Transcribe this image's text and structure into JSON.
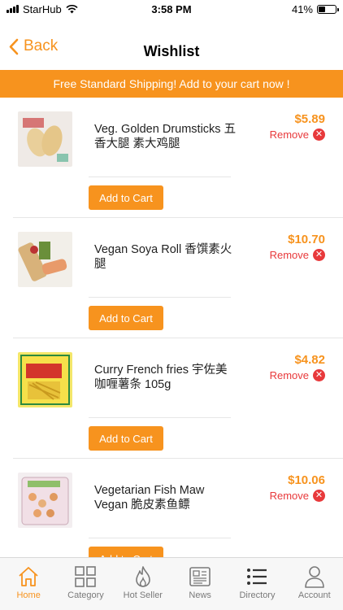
{
  "status_bar": {
    "carrier": "StarHub",
    "time": "3:58 PM",
    "battery_text": "41%",
    "battery_level": 0.41
  },
  "nav": {
    "back_label": "Back",
    "title": "Wishlist"
  },
  "banner": {
    "text": "Free Standard Shipping! Add to your cart now !"
  },
  "items": [
    {
      "name": "Veg. Golden Drumsticks 五香大腿 素大鸡腿",
      "price": "$5.89",
      "remove_label": "Remove",
      "cta": "Add to Cart"
    },
    {
      "name": "Vegan Soya Roll 香馔素火腿",
      "price": "$10.70",
      "remove_label": "Remove",
      "cta": "Add to Cart"
    },
    {
      "name": "Curry French fries 宇佐美咖喱薯条 105g",
      "price": "$4.82",
      "remove_label": "Remove",
      "cta": "Add to Cart"
    },
    {
      "name": "Vegetarian Fish Maw Vegan 脆皮素鱼鳔",
      "price": "$10.06",
      "remove_label": "Remove",
      "cta": "Add to Cart"
    }
  ],
  "tabs": [
    {
      "label": "Home",
      "icon": "home-icon",
      "active": true
    },
    {
      "label": "Category",
      "icon": "grid-icon",
      "active": false
    },
    {
      "label": "Hot Seller",
      "icon": "flame-icon",
      "active": false
    },
    {
      "label": "News",
      "icon": "newspaper-icon",
      "active": false
    },
    {
      "label": "Directory",
      "icon": "list-icon",
      "active": false
    },
    {
      "label": "Account",
      "icon": "person-icon",
      "active": false
    }
  ],
  "colors": {
    "accent": "#f7931e",
    "remove": "#e8393b"
  }
}
